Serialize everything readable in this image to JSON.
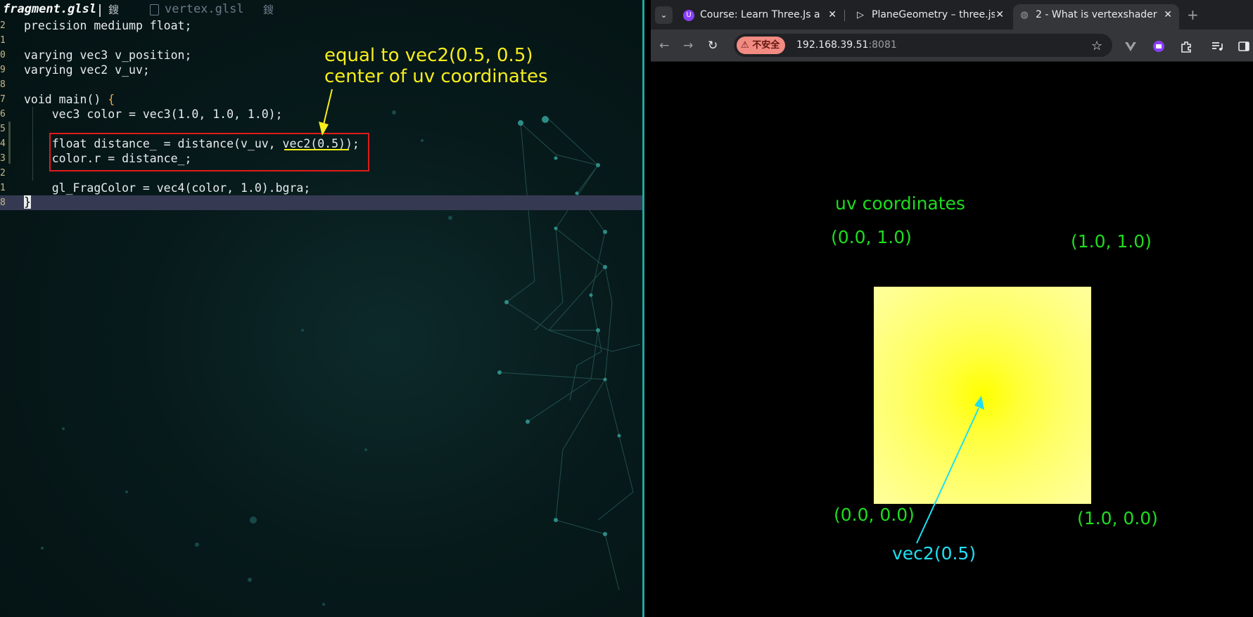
{
  "editor": {
    "tabs": [
      {
        "label": "fragment.glsl",
        "modified_glyph": "鎪"
      },
      {
        "label": "vertex.glsl",
        "modified_glyph": "鎪"
      }
    ],
    "lines": [
      {
        "num": "2",
        "text": "precision mediump float;"
      },
      {
        "num": "1",
        "text": ""
      },
      {
        "num": "0",
        "text": "varying vec3 v_position;"
      },
      {
        "num": "9",
        "text": "varying vec2 v_uv;"
      },
      {
        "num": "8",
        "text": ""
      },
      {
        "num": "7",
        "text_before": "void main() ",
        "brace": "{"
      },
      {
        "num": "6",
        "text": "    vec3 color = vec3(1.0, 1.0, 1.0);"
      },
      {
        "num": "5",
        "text": ""
      },
      {
        "num": "4",
        "text": "    float distance_ = distance(v_uv, vec2(0.5));"
      },
      {
        "num": "3",
        "text": "    color.r = distance_;"
      },
      {
        "num": "2",
        "text": ""
      },
      {
        "num": "1",
        "text": "    gl_FragColor = vec4(color, 1.0).bgra;"
      },
      {
        "num": "8",
        "cursor_char": "}"
      }
    ],
    "annotation": {
      "line1": "equal to vec2(0.5, 0.5)",
      "line2": "center of uv coordinates"
    }
  },
  "browser": {
    "tabs": [
      {
        "label": "Course: Learn Three.Js a",
        "favicon": "U",
        "favicon_color": "#8a3ffc"
      },
      {
        "label": "PlaneGeometry – three.js",
        "favicon": "▷",
        "favicon_color": "#35363a"
      },
      {
        "label": "2 - What is vertexshader",
        "favicon": "◍",
        "favicon_color": "#35363a"
      }
    ],
    "security_label": "不安全",
    "url_host": "192.168.39.51",
    "url_port": ":8081",
    "scene": {
      "title": "uv coordinates",
      "corner_top_left": "(0.0, 1.0)",
      "corner_top_right": "(1.0, 1.0)",
      "corner_bottom_left": "(0.0, 0.0)",
      "corner_bottom_right": "(1.0, 0.0)",
      "center_label": "vec2(0.5)"
    }
  },
  "colors": {
    "annotation_yellow": "#f6ee1c",
    "scene_green": "#1fdc1f",
    "arrow_cyan": "#1fe0f2",
    "highlight_red": "#e11b1b"
  }
}
